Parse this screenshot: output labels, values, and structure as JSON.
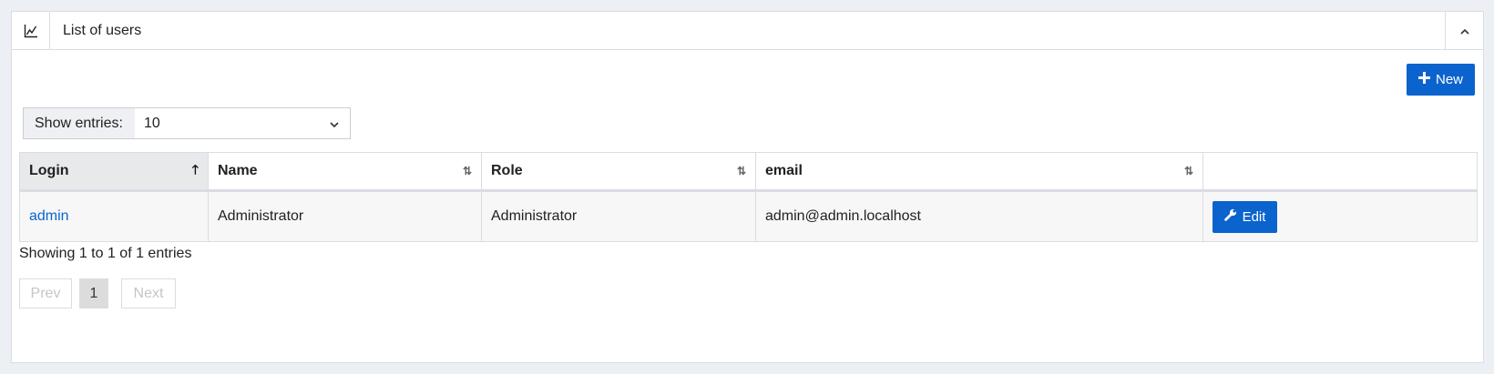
{
  "panel": {
    "title": "List of users",
    "icon": "chart-line-icon",
    "collapse_icon": "chevron-up-icon"
  },
  "toolbar": {
    "new_label": "New"
  },
  "entries": {
    "label": "Show entries:",
    "value": "10"
  },
  "table": {
    "columns": [
      "Login",
      "Name",
      "Role",
      "email",
      ""
    ],
    "sorted_column": "Login",
    "rows": [
      {
        "login": "admin",
        "name": "Administrator",
        "role": "Administrator",
        "email": "admin@admin.localhost",
        "action_label": "Edit"
      }
    ]
  },
  "footer": {
    "info": "Showing 1 to 1 of 1 entries",
    "prev_label": "Prev",
    "current_page": "1",
    "next_label": "Next"
  },
  "colors": {
    "accent": "#0b63ce",
    "link": "#0b63ce",
    "page_bg": "#eceff4"
  }
}
